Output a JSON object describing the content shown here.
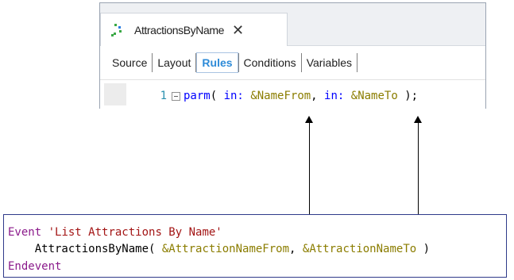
{
  "ide": {
    "doc_tab": {
      "title": "AttractionsByName",
      "close": "✕"
    },
    "part_tabs": [
      "Source",
      "Layout",
      "Rules",
      "Conditions",
      "Variables"
    ],
    "active_tab": "Rules",
    "editor": {
      "line_number": "1",
      "tokens": {
        "kw_parm": "parm",
        "open": "( ",
        "kw_in1": "in:",
        "var1": "&NameFrom",
        "comma": ", ",
        "kw_in2": "in:",
        "var2": "&NameTo",
        "close": " );"
      }
    }
  },
  "event_code": {
    "line1": {
      "keyword": "Event",
      "string": "'List Attractions By Name'"
    },
    "line2": {
      "indent": "    ",
      "object": "AttractionsByName(",
      "var1": "&AttractionNameFrom",
      "comma": ", ",
      "var2": "&AttractionNameTo",
      "close": " )"
    },
    "line3": {
      "keyword": "Endevent"
    }
  },
  "colors": {
    "keyword": "#0000ff",
    "variable": "#8b7d00",
    "event_keyword": "#8b1a8b",
    "string": "#a31515",
    "active_tab": "#2e8bd8",
    "line_number": "#2b91af"
  }
}
